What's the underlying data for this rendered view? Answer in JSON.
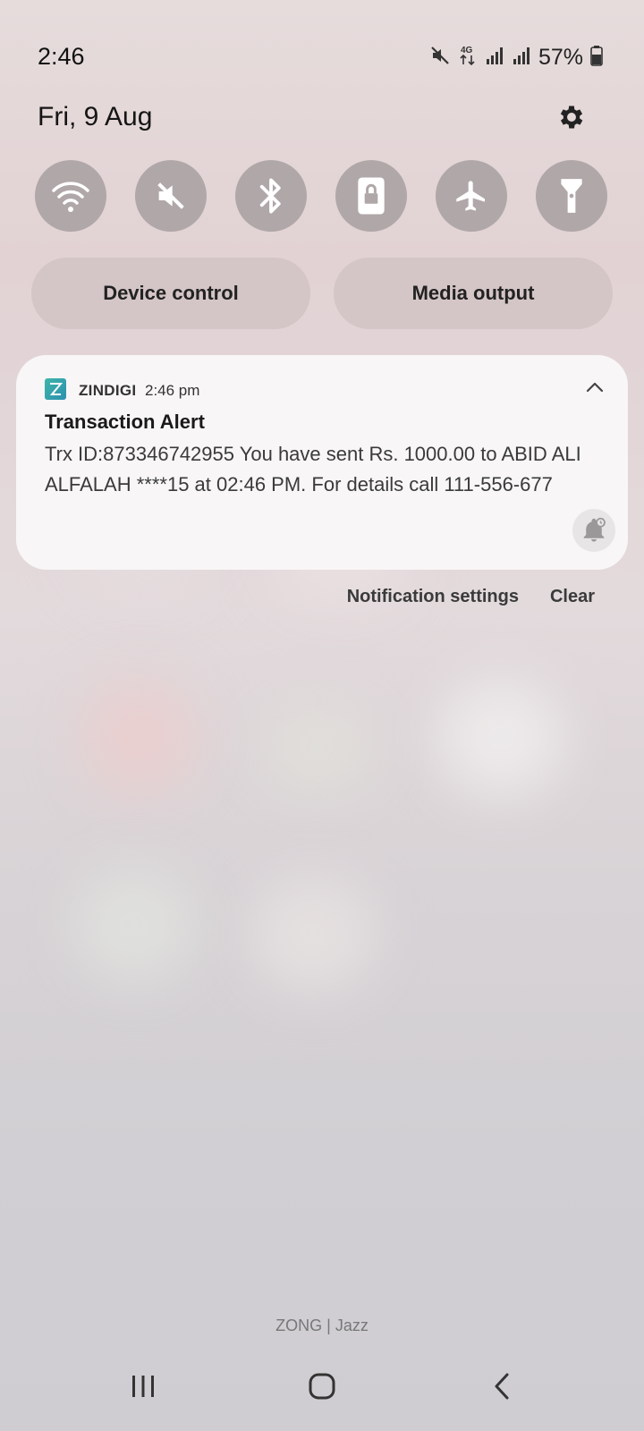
{
  "status_bar": {
    "time": "2:46",
    "network_type": "4G",
    "battery_percent": "57%",
    "icons": [
      "mute-icon",
      "4g-data-icon",
      "signal-icon",
      "signal-icon",
      "battery-icon"
    ]
  },
  "header": {
    "date": "Fri, 9 Aug",
    "settings_icon": "gear-icon"
  },
  "quick_settings": {
    "tiles": [
      {
        "name": "wifi",
        "icon": "wifi-icon",
        "active": false
      },
      {
        "name": "sound",
        "icon": "mute-icon",
        "active": false
      },
      {
        "name": "bluetooth",
        "icon": "bluetooth-icon",
        "active": false
      },
      {
        "name": "rotation-lock",
        "icon": "portrait-lock-icon",
        "active": false
      },
      {
        "name": "airplane-mode",
        "icon": "airplane-icon",
        "active": false
      },
      {
        "name": "flashlight",
        "icon": "flashlight-icon",
        "active": false
      }
    ],
    "device_control_label": "Device control",
    "media_output_label": "Media output"
  },
  "notification": {
    "app_name": "ZINDIGI",
    "time": "2:46 pm",
    "title": "Transaction Alert",
    "body": "Trx ID:873346742955 You have sent Rs. 1000.00 to ABID ALI ALFALAH ****15 at 02:46 PM.  For details call 111-556-677",
    "accent_color": "#3fb6a8"
  },
  "notification_actions": {
    "settings_label": "Notification settings",
    "clear_label": "Clear"
  },
  "footer": {
    "carrier": "ZONG | Jazz"
  },
  "nav_bar": {
    "buttons": [
      "recents-icon",
      "home-icon",
      "back-icon"
    ]
  }
}
